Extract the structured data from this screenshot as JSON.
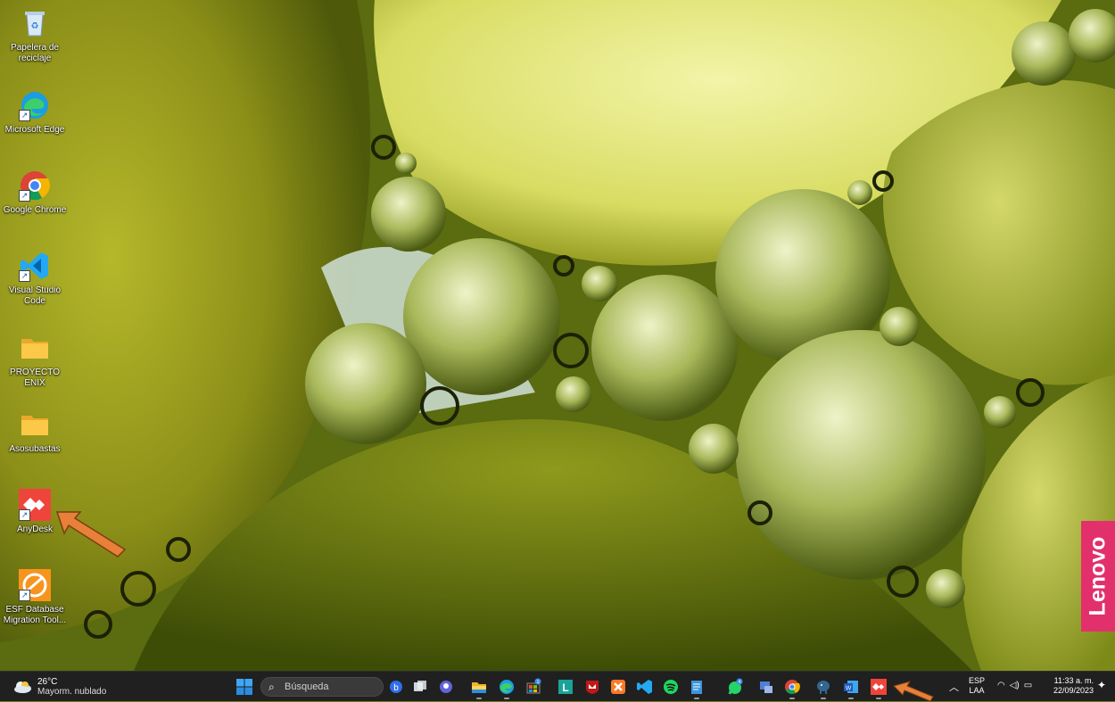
{
  "desktop": {
    "icons": [
      {
        "label": "Papelera de reciclaje",
        "icon": "recycle-bin-icon"
      },
      {
        "label": "Microsoft Edge",
        "icon": "edge-icon"
      },
      {
        "label": "Google Chrome",
        "icon": "chrome-icon"
      },
      {
        "label": "Visual Studio Code",
        "icon": "vscode-icon"
      },
      {
        "label": "PROYECTO ENIX",
        "icon": "folder-icon"
      },
      {
        "label": "Asosubastas",
        "icon": "folder-icon"
      },
      {
        "label": "AnyDesk",
        "icon": "anydesk-icon"
      },
      {
        "label": "ESF Database Migration Tool...",
        "icon": "esf-icon"
      }
    ],
    "brand": "Lenovo"
  },
  "taskbar": {
    "weather": {
      "temp": "26°C",
      "condition": "Mayorm. nublado"
    },
    "search_placeholder": "Búsqueda",
    "pinned": [
      "bing-chat-icon",
      "task-view-icon",
      "teams-chat-icon",
      "file-explorer-icon",
      "edge-icon",
      "store-icon",
      "l-app-icon",
      "mcafee-icon",
      "xampp-icon",
      "vscode-icon",
      "spotify-icon",
      "notepad-icon",
      "whatsapp-icon",
      "remote-app-icon",
      "chrome-icon",
      "postgres-icon",
      "word-icon",
      "anydesk-icon"
    ],
    "store_badge": "1",
    "whatsapp_badge": "4",
    "tray": {
      "lang_top": "ESP",
      "lang_bottom": "LAA",
      "time": "11:33 a. m.",
      "date": "22/09/2023"
    }
  },
  "colors": {
    "taskbar": "#202020",
    "lenovo": "#e2306c",
    "annotation_arrow": "#e8803a",
    "anydesk": "#ef443b"
  }
}
